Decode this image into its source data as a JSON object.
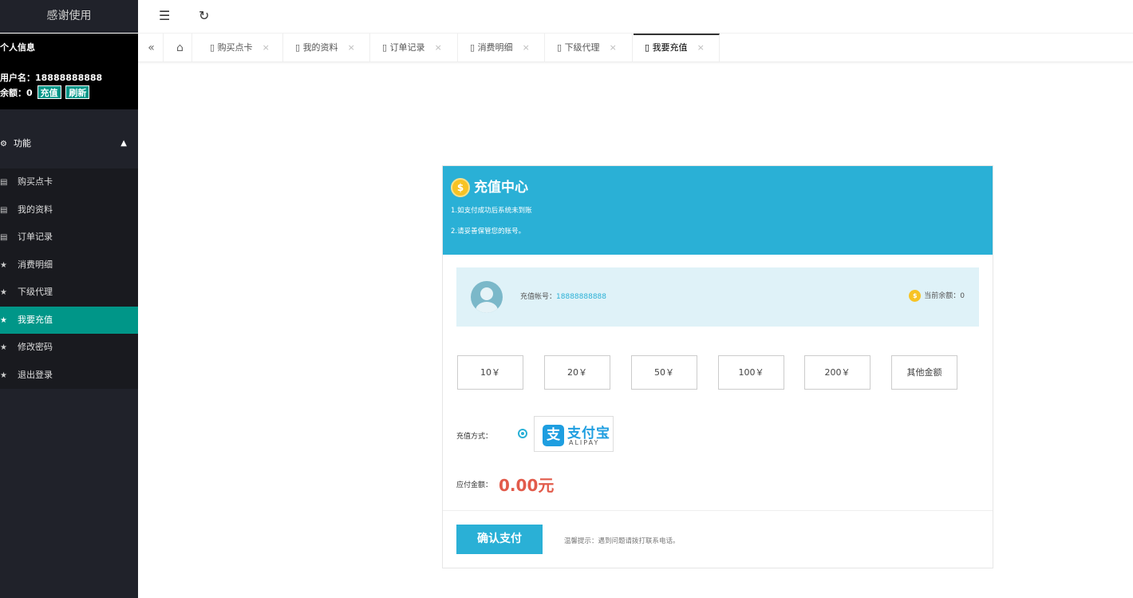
{
  "sidebar": {
    "logo": "感谢使用",
    "profile_title": "个人信息",
    "username_row": "用户名：18888888888",
    "balance_label": "余额：0",
    "recharge_btn": "充值",
    "refresh_btn": "刷新",
    "group_label": "功能",
    "items": [
      {
        "label": "购买点卡",
        "icon": "card-icon"
      },
      {
        "label": "我的资料",
        "icon": "card-icon"
      },
      {
        "label": "订单记录",
        "icon": "card-icon"
      },
      {
        "label": "消费明细",
        "icon": "star-icon"
      },
      {
        "label": "下级代理",
        "icon": "star-icon"
      },
      {
        "label": "我要充值",
        "icon": "star-icon"
      },
      {
        "label": "修改密码",
        "icon": "star-icon"
      },
      {
        "label": "退出登录",
        "icon": "star-icon"
      }
    ]
  },
  "tabs": [
    {
      "label": "购买点卡"
    },
    {
      "label": "我的资料"
    },
    {
      "label": "订单记录"
    },
    {
      "label": "消费明细"
    },
    {
      "label": "下级代理"
    },
    {
      "label": "我要充值"
    }
  ],
  "card": {
    "title": "充值中心",
    "note1": "1.如支付成功后系统未到账",
    "note2": "2.请妥善保管您的账号。",
    "account_label": "充值帐号：",
    "account_value": "18888888888",
    "balance_label": "当前余额：0",
    "amounts": [
      "10￥",
      "20￥",
      "50￥",
      "100￥",
      "200￥",
      "其他金额"
    ],
    "pay_label": "充值方式：",
    "alipay_cn": "支付宝",
    "alipay_en": "ALIPAY",
    "due_label": "应付金额：",
    "due_value": "0.00元",
    "confirm_btn": "确认支付",
    "tip": "温馨提示：遇到问题请拨打联系电话。"
  },
  "colors": {
    "accent": "#2ab0d6",
    "sidebar_active": "#009688",
    "sidebar_bg": "#20222a",
    "amount_due": "#e25b4b"
  }
}
